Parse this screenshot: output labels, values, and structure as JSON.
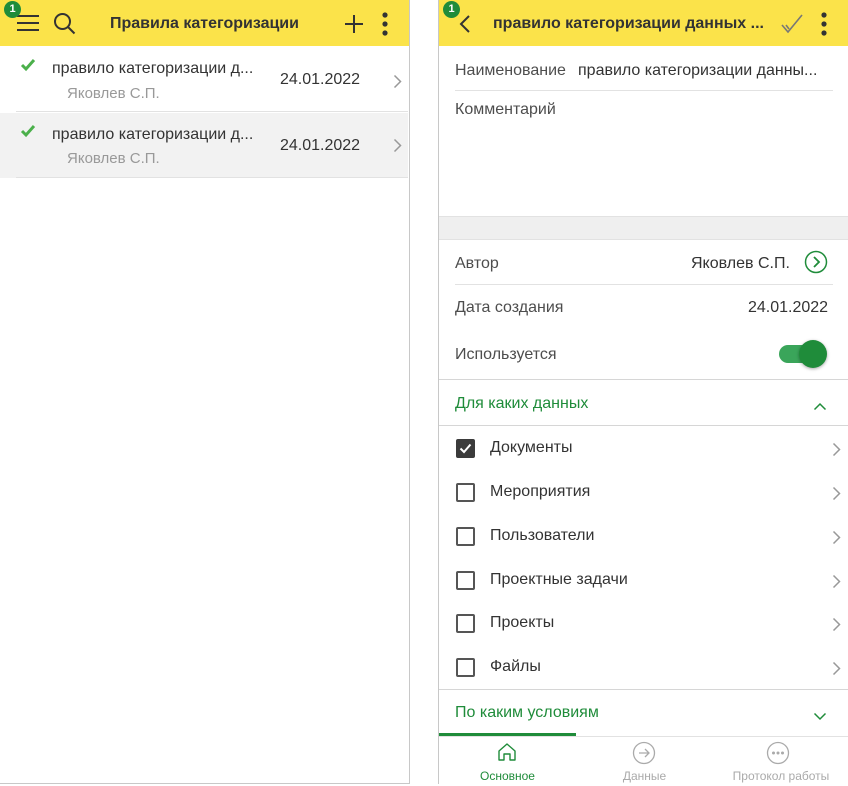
{
  "colors": {
    "header_bg": "#fbe34a",
    "accent_green": "#1f8c3a",
    "badge_bg": "#1f8c3a",
    "text_primary": "#333333",
    "text_secondary": "#999999"
  },
  "list_view": {
    "badge": "1",
    "title": "Правила категоризации",
    "icons": [
      "menu-icon",
      "search-icon",
      "add-icon",
      "more-vert-icon"
    ],
    "items": [
      {
        "name": "правило категоризации д...",
        "author": "Яковлев С.П.",
        "date": "24.01.2022",
        "checked_icon": "check-icon"
      },
      {
        "name": "правило категоризации д...",
        "author": "Яковлев С.П.",
        "date": "24.01.2022",
        "checked_icon": "check-icon",
        "selected": true
      }
    ]
  },
  "form_view": {
    "badge": "1",
    "title": "правило категоризации данных ...",
    "icons": [
      "back-icon",
      "checkmark-save-icon",
      "more-vert-icon"
    ],
    "name_label": "Наименование",
    "name_value": "правило категоризации данны...",
    "comment_label": "Комментарий",
    "author_label": "Автор",
    "author_value": "Яковлев С.П.",
    "created_label": "Дата создания",
    "created_value": "24.01.2022",
    "used_label": "Используется",
    "used_on": true,
    "section_data": {
      "title": "Для каких данных",
      "expanded": true,
      "options": [
        {
          "label": "Документы",
          "checked": true
        },
        {
          "label": "Мероприятия",
          "checked": false
        },
        {
          "label": "Пользователи",
          "checked": false
        },
        {
          "label": "Проектные задачи",
          "checked": false
        },
        {
          "label": "Проекты",
          "checked": false
        },
        {
          "label": "Файлы",
          "checked": false
        }
      ]
    },
    "section_conditions": {
      "title": "По каким условиям",
      "expanded": false
    },
    "tabs": [
      {
        "label": "Основное",
        "icon": "home-icon",
        "active": true
      },
      {
        "label": "Данные",
        "icon": "arrow-right-circle-icon",
        "active": false
      },
      {
        "label": "Протокол работы",
        "icon": "more-horiz-circle-icon",
        "active": false
      }
    ]
  }
}
